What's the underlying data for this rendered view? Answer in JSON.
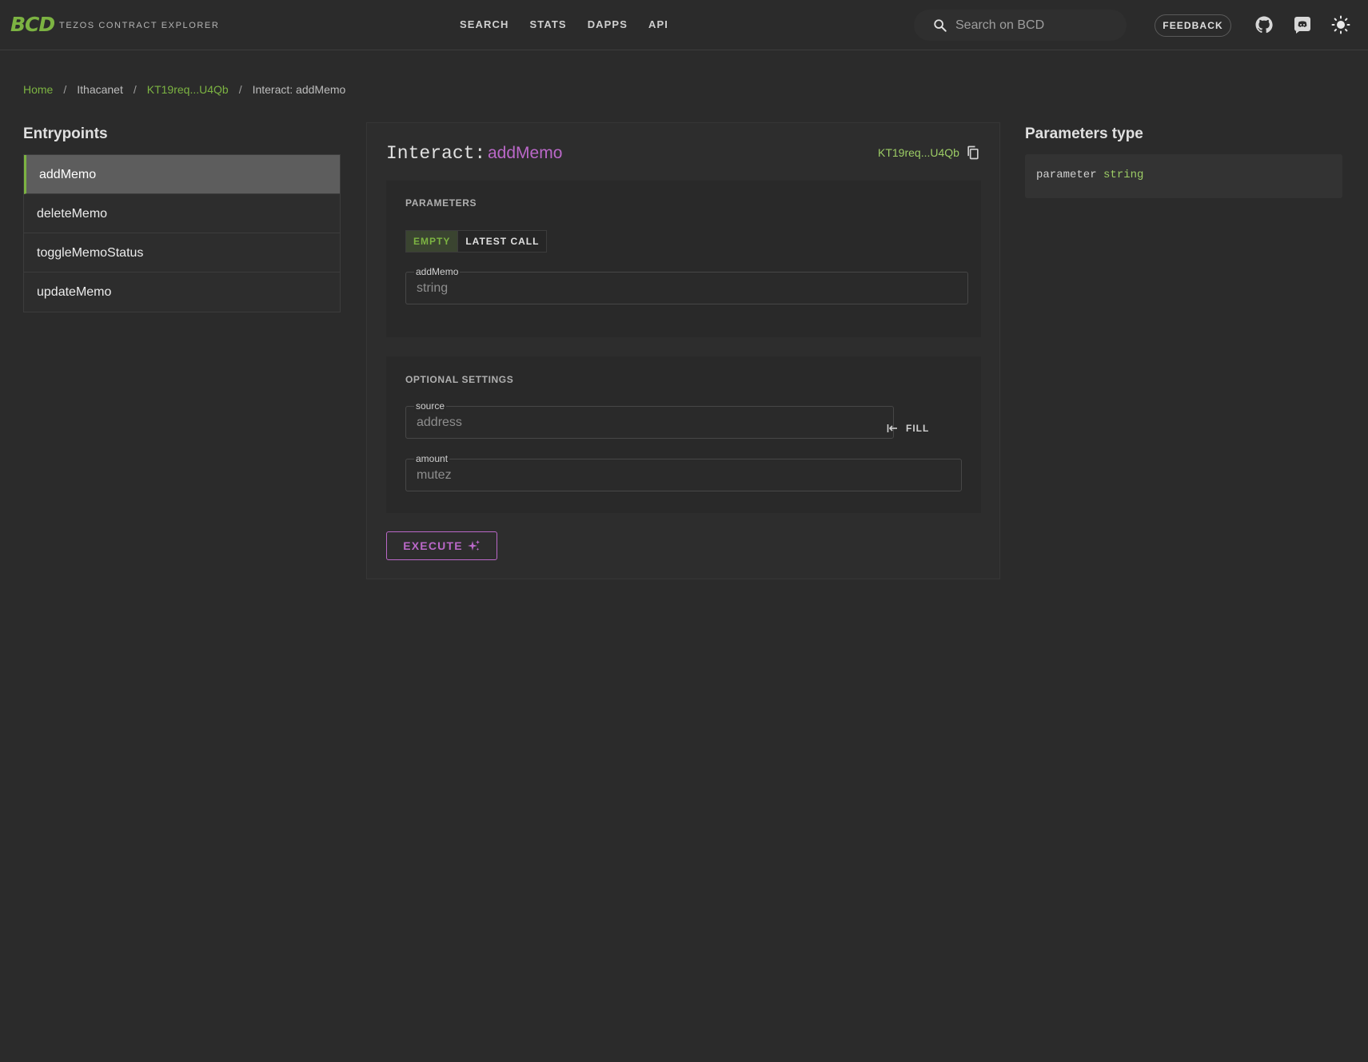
{
  "header": {
    "logo": "BCD",
    "subtitle": "TEZOS CONTRACT EXPLORER",
    "nav": [
      "SEARCH",
      "STATS",
      "DAPPS",
      "API"
    ],
    "search_placeholder": "Search on BCD",
    "feedback_label": "FEEDBACK"
  },
  "breadcrumb": {
    "home": "Home",
    "network": "Ithacanet",
    "contract": "KT19req...U4Qb",
    "current": "Interact: addMemo",
    "separator": "/"
  },
  "entrypoints": {
    "title": "Entrypoints",
    "items": [
      "addMemo",
      "deleteMemo",
      "toggleMemoStatus",
      "updateMemo"
    ],
    "active": "addMemo"
  },
  "interact": {
    "label": "Interact:",
    "name": "addMemo",
    "contract_short": "KT19req...U4Qb",
    "parameters": {
      "label": "PARAMETERS",
      "toggle_empty": "EMPTY",
      "toggle_latest": "LATEST CALL",
      "field_label": "addMemo",
      "field_placeholder": "string"
    },
    "optional": {
      "label": "OPTIONAL SETTINGS",
      "source_label": "source",
      "source_placeholder": "address",
      "fill_label": "FILL",
      "amount_label": "amount",
      "amount_placeholder": "mutez"
    },
    "execute_label": "EXECUTE"
  },
  "params_type": {
    "title": "Parameters type",
    "keyword": "parameter",
    "type": "string"
  },
  "colors": {
    "accent_green": "#7cb342",
    "accent_purple": "#ba68c8",
    "background": "#2b2b2b"
  }
}
